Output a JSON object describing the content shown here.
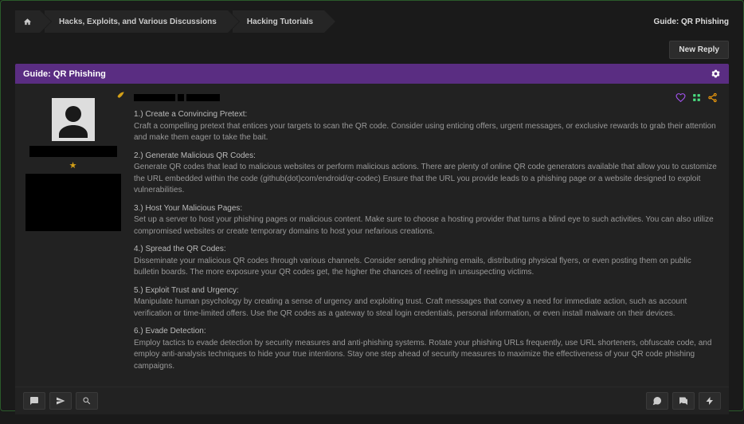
{
  "breadcrumbs": {
    "items": [
      {
        "label": "Hacks, Exploits, and Various Discussions"
      },
      {
        "label": "Hacking Tutorials"
      }
    ],
    "title": "Guide: QR Phishing"
  },
  "buttons": {
    "new_reply": "New Reply"
  },
  "thread": {
    "title": "Guide: QR Phishing"
  },
  "post": {
    "sections": [
      {
        "h": "1.) Create a Convincing Pretext:",
        "t": "Craft a compelling pretext that entices your targets to scan the QR code. Consider using enticing offers, urgent messages, or exclusive rewards to grab their attention and make them eager to take the bait."
      },
      {
        "h": "2.) Generate Malicious QR Codes:",
        "t": "Generate QR codes that lead to malicious websites or perform malicious actions. There are plenty of online QR code generators available that allow you to customize the URL embedded within the code (github(dot)com/endroid/qr-codec) Ensure that the URL you provide leads to a phishing page or a website designed to exploit vulnerabilities."
      },
      {
        "h": "3.) Host Your Malicious Pages:",
        "t": "Set up a server to host your phishing pages or malicious content. Make sure to choose a hosting provider that turns a blind eye to such activities. You can also utilize compromised websites or create temporary domains to host your nefarious creations."
      },
      {
        "h": "4.) Spread the QR Codes:",
        "t": "Disseminate your malicious QR codes through various channels. Consider sending phishing emails, distributing physical flyers, or even posting them on public bulletin boards. The more exposure your QR codes get, the higher the chances of reeling in unsuspecting victims."
      },
      {
        "h": "5.) Exploit Trust and Urgency:",
        "t": "Manipulate human psychology by creating a sense of urgency and exploiting trust. Craft messages that convey a need for immediate action, such as account verification or time-limited offers. Use the QR codes as a gateway to steal login credentials, personal information, or even install malware on their devices."
      },
      {
        "h": "6.) Evade Detection:",
        "t": "Employ tactics to evade detection by security measures and anti-phishing systems. Rotate your phishing URLs frequently, use URL shorteners, obfuscate code, and employ anti-analysis techniques to hide your true intentions. Stay one step ahead of security measures to maximize the effectiveness of your QR code phishing campaigns."
      }
    ]
  },
  "icons": {
    "home": "home-icon",
    "gear": "gear-icon",
    "feather": "feather-icon",
    "heart": "heart-icon",
    "tree": "tree-icon",
    "share": "share-icon",
    "chat": "chat-icon",
    "send": "send-icon",
    "search": "search-icon",
    "comment": "comment-icon",
    "comments": "comments-icon",
    "bolt": "bolt-icon"
  },
  "colors": {
    "accent": "#5a2d82",
    "gold": "#d4a017",
    "heart": "#a855f7",
    "tree": "#4ade80",
    "share": "#f59e0b"
  }
}
